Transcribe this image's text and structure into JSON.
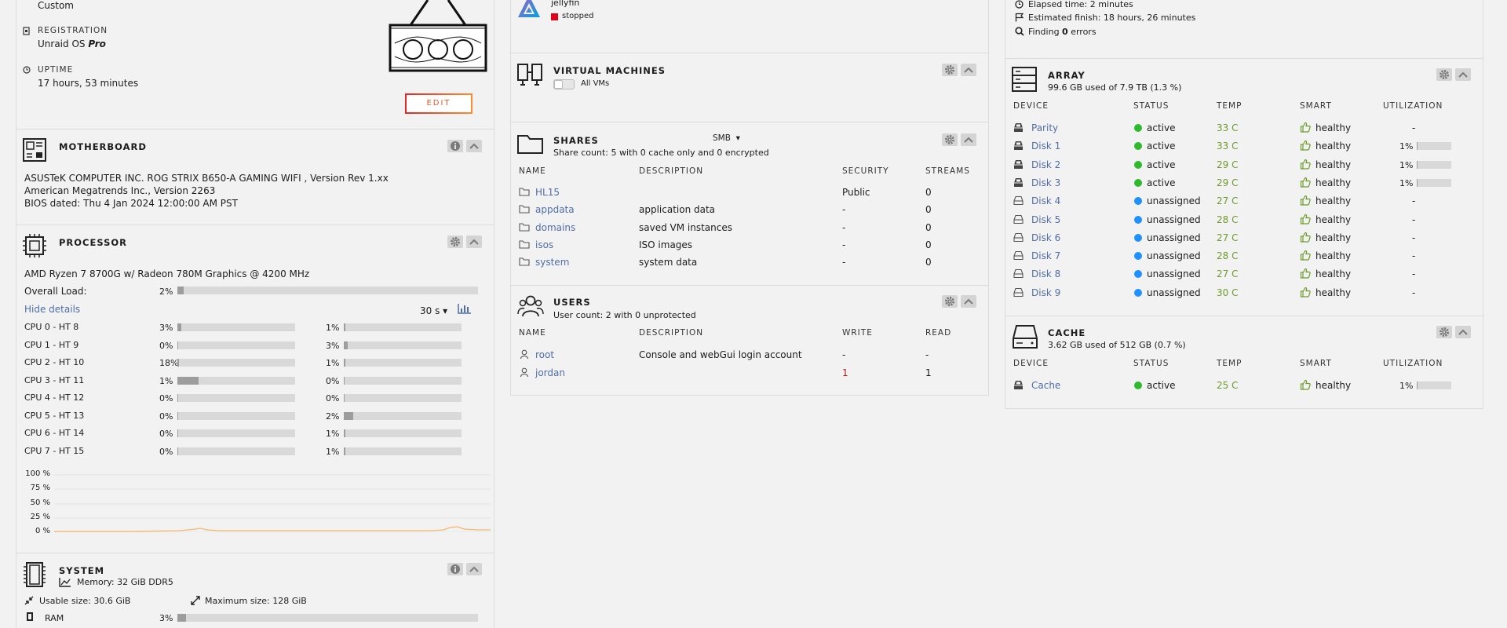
{
  "vars": {
    "custom": "Custom",
    "registration_label": "REGISTRATION",
    "registration_value_plain": "Unraid OS ",
    "registration_value_bold": "Pro",
    "uptime_label": "UPTIME",
    "uptime_value": "17 hours, 53 minutes",
    "edit_label": "EDIT"
  },
  "motherboard": {
    "title": "MOTHERBOARD",
    "line1": "ASUSTeK COMPUTER INC. ROG STRIX B650-A GAMING WIFI , Version Rev 1.xx",
    "line2": "American Megatrends Inc., Version 2263",
    "line3": "BIOS dated: Thu 4 Jan 2024 12:00:00 AM PST"
  },
  "processor": {
    "title": "PROCESSOR",
    "model": "AMD Ryzen 7 8700G w/ Radeon 780M Graphics @ 4200 MHz",
    "overall_label": "Overall Load:",
    "overall_value": "2%",
    "overall_pct": 2,
    "hide_details": "Hide details",
    "interval": "30 s",
    "cpus": [
      {
        "label": "CPU 0 - HT 8",
        "a": "3%",
        "ap": 3,
        "b": "1%",
        "bp": 1
      },
      {
        "label": "CPU 1 - HT 9",
        "a": "0%",
        "ap": 0,
        "b": "3%",
        "bp": 3
      },
      {
        "label": "CPU 2 - HT 10",
        "a": "18%",
        "ap": 1,
        "b": "1%",
        "bp": 1
      },
      {
        "label": "CPU 3 - HT 11",
        "a": "1%",
        "ap": 18,
        "b": "0%",
        "bp": 0
      },
      {
        "label": "CPU 4 - HT 12",
        "a": "0%",
        "ap": 0,
        "b": "0%",
        "bp": 0
      },
      {
        "label": "CPU 5 - HT 13",
        "a": "0%",
        "ap": 0,
        "b": "2%",
        "bp": 8
      },
      {
        "label": "CPU 6 - HT 14",
        "a": "0%",
        "ap": 0,
        "b": "1%",
        "bp": 1
      },
      {
        "label": "CPU 7 - HT 15",
        "a": "0%",
        "ap": 0,
        "b": "1%",
        "bp": 1
      }
    ],
    "graph_ticks": [
      "100 %",
      "75 %",
      "50 %",
      "25 %",
      "0 %"
    ]
  },
  "system": {
    "title": "SYSTEM",
    "memory": "Memory: 32 GiB DDR5",
    "usable": "Usable size: 30.6 GiB",
    "maximum": "Maximum size: 128 GiB",
    "ram_label": "RAM",
    "ram_value": "3%",
    "ram_pct": 3
  },
  "docker": {
    "name": "jellyfin",
    "status": "stopped"
  },
  "vms": {
    "title": "VIRTUAL MACHINES",
    "toggle_label": "All VMs"
  },
  "shares": {
    "title": "SHARES",
    "protocol": "SMB",
    "summary": "Share count: 5 with 0 cache only and 0 encrypted",
    "headers": [
      "NAME",
      "DESCRIPTION",
      "SECURITY",
      "STREAMS"
    ],
    "rows": [
      {
        "name": "HL15",
        "desc": "",
        "security": "Public",
        "streams": "0"
      },
      {
        "name": "appdata",
        "desc": "application data",
        "security": "-",
        "streams": "0"
      },
      {
        "name": "domains",
        "desc": "saved VM instances",
        "security": "-",
        "streams": "0"
      },
      {
        "name": "isos",
        "desc": "ISO images",
        "security": "-",
        "streams": "0"
      },
      {
        "name": "system",
        "desc": "system data",
        "security": "-",
        "streams": "0"
      }
    ]
  },
  "users": {
    "title": "USERS",
    "summary": "User count: 2 with 0 unprotected",
    "headers": [
      "NAME",
      "DESCRIPTION",
      "WRITE",
      "READ"
    ],
    "rows": [
      {
        "name": "root",
        "desc": "Console and webGui login account",
        "write": "-",
        "read": "-"
      },
      {
        "name": "jordan",
        "desc": "",
        "write": "1",
        "read": "1"
      }
    ]
  },
  "parity": {
    "elapsed": "Elapsed time: 2 minutes",
    "estimated": "Estimated finish: 18 hours, 26 minutes",
    "finding_pre": "Finding ",
    "finding_num": "0",
    "finding_post": " errors"
  },
  "array": {
    "title": "ARRAY",
    "summary": "99.6 GB used of 7.9 TB (1.3 %)",
    "headers": [
      "DEVICE",
      "STATUS",
      "TEMP",
      "SMART",
      "UTILIZATION"
    ],
    "rows": [
      {
        "device": "Parity",
        "status": "active",
        "temp": "33 C",
        "smart": "healthy",
        "util": "-",
        "pct": null,
        "type": "active"
      },
      {
        "device": "Disk 1",
        "status": "active",
        "temp": "33 C",
        "smart": "healthy",
        "util": "1%",
        "pct": 1,
        "type": "active"
      },
      {
        "device": "Disk 2",
        "status": "active",
        "temp": "29 C",
        "smart": "healthy",
        "util": "1%",
        "pct": 1,
        "type": "active"
      },
      {
        "device": "Disk 3",
        "status": "active",
        "temp": "29 C",
        "smart": "healthy",
        "util": "1%",
        "pct": 1,
        "type": "active"
      },
      {
        "device": "Disk 4",
        "status": "unassigned",
        "temp": "27 C",
        "smart": "healthy",
        "util": "-",
        "pct": null,
        "type": "unassigned"
      },
      {
        "device": "Disk 5",
        "status": "unassigned",
        "temp": "28 C",
        "smart": "healthy",
        "util": "-",
        "pct": null,
        "type": "unassigned"
      },
      {
        "device": "Disk 6",
        "status": "unassigned",
        "temp": "27 C",
        "smart": "healthy",
        "util": "-",
        "pct": null,
        "type": "unassigned"
      },
      {
        "device": "Disk 7",
        "status": "unassigned",
        "temp": "28 C",
        "smart": "healthy",
        "util": "-",
        "pct": null,
        "type": "unassigned"
      },
      {
        "device": "Disk 8",
        "status": "unassigned",
        "temp": "27 C",
        "smart": "healthy",
        "util": "-",
        "pct": null,
        "type": "unassigned"
      },
      {
        "device": "Disk 9",
        "status": "unassigned",
        "temp": "30 C",
        "smart": "healthy",
        "util": "-",
        "pct": null,
        "type": "unassigned"
      }
    ]
  },
  "cache": {
    "title": "CACHE",
    "summary": "3.62 GB used of 512 GB (0.7 %)",
    "headers": [
      "DEVICE",
      "STATUS",
      "TEMP",
      "SMART",
      "UTILIZATION"
    ],
    "rows": [
      {
        "device": "Cache",
        "status": "active",
        "temp": "25 C",
        "smart": "healthy",
        "util": "1%",
        "pct": 1
      }
    ]
  },
  "colors": {
    "link": "#4f6ea8",
    "active": "#2dbb2d",
    "unassigned": "#1e90ff",
    "temp": "#6e9b2b",
    "stopped": "#e0001a",
    "graph_line": "#f4b76b"
  }
}
